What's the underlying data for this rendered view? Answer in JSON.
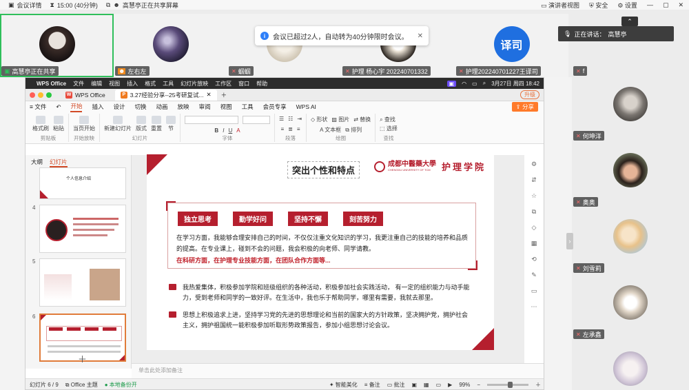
{
  "meeting": {
    "record_label": "会议详情",
    "timer": "15:00 (40分钟)",
    "sharing_status": "高慧亭正在共享屏幕",
    "view_label": "演讲者视图",
    "security_label": "安全",
    "settings_label": "设置"
  },
  "toast": {
    "text": "会议已超过2人，自动转为40分钟限时会议。"
  },
  "participants_top": [
    {
      "name": "高慧亭正在共享"
    },
    {
      "name": "左右左"
    },
    {
      "name": "蝈蝈"
    },
    {
      "name": "护理 杨心宇 202240701332"
    },
    {
      "name": "护理202240701227王译司",
      "avatar_text": "译司"
    }
  ],
  "speaking": {
    "label": "正在讲话：",
    "name": "高慧亭"
  },
  "participants_right": [
    {
      "name": "f"
    },
    {
      "name": "何坤洋"
    },
    {
      "name": "奥奥"
    },
    {
      "name": "刘雪莉"
    },
    {
      "name": "左承鑫"
    }
  ],
  "mac": {
    "app": "WPS Office",
    "menus": [
      "文件",
      "编辑",
      "视图",
      "插入",
      "格式",
      "工具",
      "幻灯片放映",
      "工作区",
      "窗口",
      "帮助"
    ],
    "datetime": "3月27日 周四  18:42"
  },
  "wps": {
    "tabs": [
      {
        "label": "WPS Office"
      },
      {
        "label": "3.27经验分享--25考研复试..."
      }
    ],
    "upgrade": "升级",
    "file_label": "文件",
    "menu": [
      "开始",
      "插入",
      "设计",
      "切换",
      "动画",
      "放映",
      "审阅",
      "视图",
      "工具",
      "会员专享",
      "WPS AI"
    ],
    "share": "分享",
    "ribbon": {
      "groups": [
        {
          "label": "剪贴板",
          "buttons": [
            "格式刷",
            "粘贴"
          ]
        },
        {
          "label": "开始放映",
          "buttons": [
            "当页开始"
          ]
        },
        {
          "label": "幻灯片",
          "buttons": [
            "新建幻灯片",
            "版式",
            "重置",
            "节"
          ]
        },
        {
          "label": "字体",
          "buttons": []
        },
        {
          "label": "段落",
          "buttons": []
        },
        {
          "label": "绘图",
          "buttons": [
            "形状",
            "文本框",
            "图片",
            "排列",
            "替换"
          ]
        },
        {
          "label": "查找",
          "buttons": [
            "查找",
            "选择"
          ]
        }
      ]
    },
    "side_tabs": [
      "大纲",
      "幻灯片"
    ],
    "thumb3_title": "个人信息介绍",
    "thumb_numbers": [
      "4",
      "5",
      "6"
    ],
    "notes_placeholder": "单击此处添加备注",
    "status": {
      "slide": "幻灯片 6 / 9",
      "theme": "Office 主题",
      "backup": "本地备份开",
      "beautify": "智能美化",
      "notes": "备注",
      "comment": "批注",
      "zoom": "99%"
    }
  },
  "slide": {
    "title": "突出个性和特点",
    "uni_name": "成都中醫藥大學",
    "uni_en": "CHENGDU UNIVERSITY OF TCM",
    "dept": "护理学院",
    "tags": [
      "独立思考",
      "勤学好问",
      "坚持不懈",
      "刻苦努力"
    ],
    "para1": "在学习方面，我能够合理安排自己的时间，不仅仅注重文化知识的学习，我更注重自己的技能的培养和品质的提高。在专业课上，碰到不会的问题，我会积极的向老师、同学请教。",
    "para1_red": "在科研方面，在护理专业技能方面，在团队合作方面等...",
    "bullet1": "我热爱集体，积极参加学院和班级组织的各种活动，积极参加社会实践活动，  有一定的组织能力与动手能力，受到老师和同学的一致好评。在生活中，我也乐于帮助同学，哪里有需要，我就去那里。",
    "bullet2": "思想上积极追求上进，坚持学习党的先进的思想理论和当前的国家大的方针政策，坚决拥护党，拥护社会主义，拥护祖国统一能积极参加听取形势政策报告，参加小组思想讨论会议。"
  },
  "colors": {
    "accent_red": "#b51f2e",
    "wps_orange": "#ff7a2a",
    "speaking_green": "#2fbf5b",
    "toast_blue": "#2d7ff9"
  },
  "icons": [
    "record-icon",
    "timer-icon",
    "share-icon",
    "mic-muted-icon",
    "info-icon",
    "close-icon",
    "gear-icon",
    "shield-icon",
    "view-icon"
  ]
}
